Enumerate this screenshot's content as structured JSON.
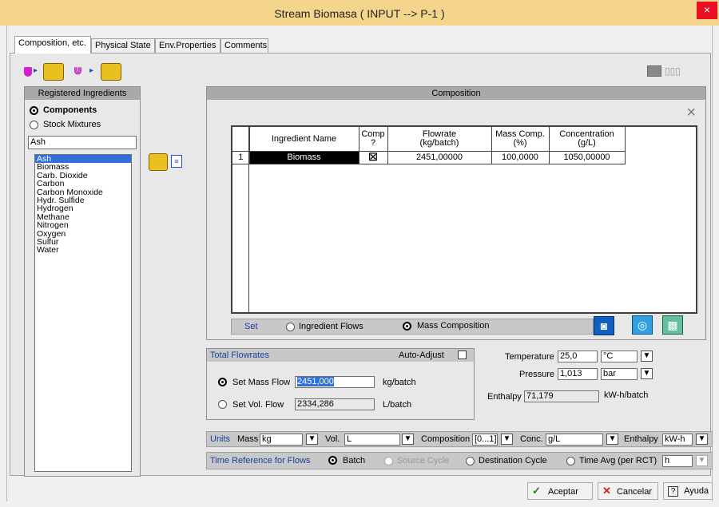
{
  "window": {
    "title": "Stream Biomasa ( INPUT --> P-1 )",
    "close": "×"
  },
  "tabs": [
    "Composition, etc.",
    "Physical State",
    "Env.Properties",
    "Comments"
  ],
  "left": {
    "header": "Registered Ingredients",
    "radio_components": "Components",
    "radio_stock": "Stock Mixtures",
    "search": "Ash",
    "items": [
      "Ash",
      "Biomass",
      "Carb. Dioxide",
      "Carbon",
      "Carbon Monoxide",
      "Hydr. Sulfide",
      "Hydrogen",
      "Methane",
      "Nitrogen",
      "Oxygen",
      "Sulfur",
      "Water"
    ]
  },
  "composition": {
    "header": "Composition",
    "close": "×",
    "columns": [
      "Ingredient Name",
      "Comp\n?",
      "Flowrate\n(kg/batch)",
      "Mass Comp.\n(%)",
      "Concentration\n(g/L)"
    ],
    "rows": [
      {
        "num": "1",
        "name": "Biomass",
        "comp": "☒",
        "flow": "2451,00000",
        "mass": "100,0000",
        "conc": "1050,00000"
      }
    ],
    "set_label": "Set",
    "opt_flows": "Ingredient Flows",
    "opt_mass": "Mass Composition"
  },
  "totals": {
    "header": "Total Flowrates",
    "auto_adjust": "Auto-Adjust",
    "mass_label": "Set Mass Flow",
    "mass_value": "2451,000",
    "mass_unit": "kg/batch",
    "vol_label": "Set Vol. Flow",
    "vol_value": "2334,286",
    "vol_unit": "L/batch"
  },
  "state": {
    "temp_label": "Temperature",
    "temp_value": "25,0",
    "temp_unit": "°C",
    "press_label": "Pressure",
    "press_value": "1,013",
    "press_unit": "bar",
    "enth_label": "Enthalpy",
    "enth_value": "71,179",
    "enth_unit": "kW-h/batch"
  },
  "units": {
    "label": "Units",
    "mass_label": "Mass",
    "mass": "kg",
    "vol_label": "Vol.",
    "vol": "L",
    "comp_label": "Composition",
    "comp": "[0...1]",
    "conc_label": "Conc.",
    "conc": "g/L",
    "enth_label": "Enthalpy",
    "enth": "kW-h"
  },
  "timeref": {
    "label": "Time Reference for Flows",
    "batch": "Batch",
    "source": "Source Cycle",
    "dest": "Destination Cycle",
    "avg": "Time Avg (per RCT)",
    "avg_unit": "h"
  },
  "buttons": {
    "ok": "Aceptar",
    "cancel": "Cancelar",
    "help": "Ayuda"
  }
}
